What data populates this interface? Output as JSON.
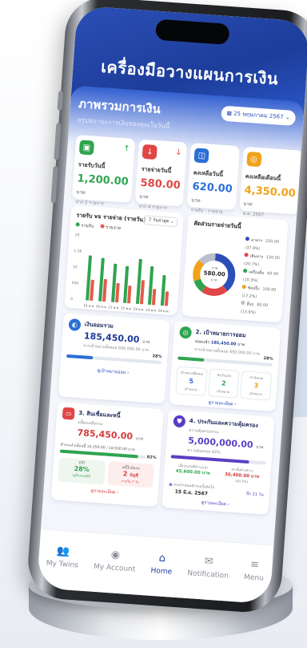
{
  "header": {
    "title": "เครื่องมือวางแผนการเงิน"
  },
  "overview": {
    "title": "ภาพรวมการเงิน",
    "subtitle": "สรุปสถานะการเงินของคุณในวันนี้",
    "date": "25 พฤษภาคม 2567"
  },
  "kpis": [
    {
      "label": "รายรับวันนี้",
      "value": "1,200.00",
      "unit": "บาท",
      "note": "จาก 2 รายการ",
      "icon": "wallet-icon",
      "color": "#2fa44f",
      "trend": "up"
    },
    {
      "label": "รายจ่ายวันนี้",
      "value": "580.00",
      "unit": "บาท",
      "note": "จาก 4 รายการ",
      "icon": "arrow-down-icon",
      "color": "#e04646",
      "trend": "down"
    },
    {
      "label": "คงเหลือวันนี้",
      "value": "620.00",
      "unit": "บาท",
      "note": "รายรับ - รายจ่าย",
      "icon": "balance-icon",
      "color": "#2b6fd6",
      "trend": ""
    },
    {
      "label": "คงเหลือเดือนนี้",
      "value": "4,350.00",
      "unit": "บาท",
      "note": "พ.ค. 2567",
      "icon": "coins-icon",
      "color": "#f0a21a",
      "trend": ""
    }
  ],
  "income_chart": {
    "title": "รายรับ vs รายจ่าย (รายวัน)",
    "range": "7 วันล่าสุด",
    "legend": [
      "รายรับ",
      "รายจ่าย"
    ]
  },
  "chart_data": {
    "type": "bar",
    "categories": [
      "19 พ.ค.",
      "20 พ.ค.",
      "21 พ.ค.",
      "22 พ.ค.",
      "23 พ.ค.",
      "24 พ.ค.",
      "25 พ.ค."
    ],
    "series": [
      {
        "name": "รายรับ",
        "values": [
          1400,
          1350,
          1200,
          1150,
          1400,
          1200,
          950
        ],
        "color": "#2fa44f"
      },
      {
        "name": "รายจ่าย",
        "values": [
          650,
          700,
          600,
          550,
          750,
          500,
          450
        ],
        "color": "#e65a4a"
      }
    ],
    "yticks": [
      "2K",
      "1.5K",
      "1K",
      "500",
      "0"
    ],
    "ylim": [
      0,
      2000
    ]
  },
  "expense_chart": {
    "title": "สัดส่วนรายจ่ายวันนี้",
    "center_label": "รวม",
    "center_value": "580.00",
    "center_unit": "บาท",
    "items": [
      {
        "name": "อาหาร",
        "value": "220.00 (37.9%)",
        "color": "#2b4fb6"
      },
      {
        "name": "เดินทาง",
        "value": "120.00 (20.7%)",
        "color": "#e04646"
      },
      {
        "name": "เครื่องดื่ม",
        "value": "60.00 (10.3%)",
        "color": "#2fa44f"
      },
      {
        "name": "ช้อปปิ้ง",
        "value": "100.00 (17.2%)",
        "color": "#f0a21a"
      },
      {
        "name": "อื่นๆ",
        "value": "80.00 (13.9%)",
        "color": "#b9bfcc"
      }
    ]
  },
  "savings": {
    "title": "เงินออมรวม",
    "value": "185,450.00",
    "unit": "บาท",
    "note": "จากเป้าหมายทั้งหมด 650,000.00 บาท",
    "percent": "28%",
    "progress": 0.28,
    "link": "ดูเป้าหมายออม"
  },
  "goals": {
    "title": "2. เป้าหมายการออม",
    "saved_label": "ออมแล้ว",
    "value": "185,450.00",
    "unit": "บาท",
    "note": "จากเป้าหมายทั้งหมด 650,000.00 บาท",
    "percent": "28%",
    "progress": 0.28,
    "stats": [
      {
        "label": "เป้าหมายทั้งหมด",
        "num": "5",
        "sub": "เป้าหมาย"
      },
      {
        "label": "สำเร็จแล้ว",
        "num": "2",
        "sub": "เป้าหมาย"
      },
      {
        "label": "กำลังออม",
        "num": "3",
        "sub": "เป้าหมาย"
      }
    ],
    "link": "ดูรายละเอียด"
  },
  "debt": {
    "title": "3. สินเชื่อและหนี้",
    "sub": "หนี้คงเหลือรวม",
    "value": "785,450.00",
    "unit": "บาท",
    "paid_note": "ชำระแล้วเดือนนี้ 15,250.00 / 18,500.00 บาท",
    "percent": "82%",
    "progress": 0.82,
    "box1_label": "DTI",
    "box1_value": "28%",
    "box1_note": "อยู่ในเกณฑ์ดี",
    "box2_label": "หนี้ใกล้ครบ",
    "box2_value": "2",
    "box2_unit": "บัญชี",
    "box2_note": "ภายใน 7 วัน",
    "link": "ดูรายละเอียด"
  },
  "insurance": {
    "title": "4. ประกันและความคุ้มครอง",
    "sub": "ความคุ้มครองรวม",
    "value": "5,000,000.00",
    "unit": "บาท",
    "coverage": "ความคุ้มครอง 82%",
    "progress": 0.82,
    "paid_label": "เบี้ยประกันที่ชำระแล้ว",
    "paid_value": "45,600.00 บาท",
    "due_label": "ค่าเบี้ยค้างชำระ",
    "due_value": "30,400.00 บาท",
    "due_pct": "(40.7%)",
    "next_label": "ครบกำหนดชำระครั้งถัดไป",
    "next_date": "15 มิ.ย. 2567",
    "days_left": "อีก 21 วัน",
    "link": "ดูรายละเอียด"
  },
  "tabs": [
    {
      "label": "My Twins",
      "icon": "people-icon",
      "glyph": "👥"
    },
    {
      "label": "My Account",
      "icon": "user-icon",
      "glyph": "◉"
    },
    {
      "label": "Home",
      "icon": "home-icon",
      "glyph": "⌂"
    },
    {
      "label": "Notification",
      "icon": "mail-icon",
      "glyph": "✉"
    },
    {
      "label": "Menu",
      "icon": "menu-icon",
      "glyph": "≡"
    }
  ]
}
